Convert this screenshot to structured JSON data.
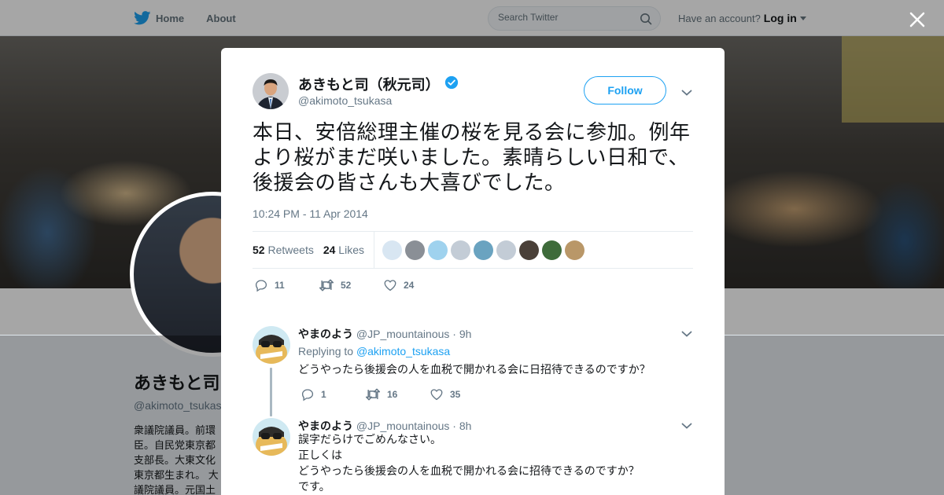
{
  "topbar": {
    "home_label": "Home",
    "about_label": "About",
    "search_placeholder": "Search Twitter",
    "account_prompt": "Have an account?",
    "login_label": "Log in"
  },
  "profile": {
    "name": "あきもと司",
    "handle": "@akimoto_tsukasa",
    "bio_lines": [
      "衆議院議員。前環",
      "臣。自民党東京都",
      "支部長。大東文化",
      "東京都生まれ。 大",
      "議院議員。元国土"
    ]
  },
  "tweet": {
    "author_name": "あきもと司（秋元司）",
    "author_handle": "@akimoto_tsukasa",
    "follow_label": "Follow",
    "text": "本日、安倍総理主催の桜を見る会に参加。例年より桜がまだ咲いました。素晴らしい日和で、後援会の皆さんも大喜びでした。",
    "timestamp": "10:24 PM - 11 Apr 2014",
    "retweets_count": "52",
    "retweets_label": "Retweets",
    "likes_count": "24",
    "likes_label": "Likes",
    "likers": [
      {
        "color": "#d8e6f2"
      },
      {
        "color": "#8a8f96"
      },
      {
        "color": "#9fd2ee"
      },
      {
        "color": "#c3ccd6"
      },
      {
        "color": "#6aa3c0"
      },
      {
        "color": "#c3ccd6"
      },
      {
        "color": "#4a4038"
      },
      {
        "color": "#3e6b3a"
      },
      {
        "color": "#b99768"
      }
    ],
    "actions": {
      "replies": "11",
      "retweets": "52",
      "likes": "24"
    }
  },
  "replies": [
    {
      "name": "やまのよう",
      "handle": "@JP_mountainous",
      "time": "· 9h",
      "replying_prefix": "Replying to",
      "replying_to": "@akimoto_tsukasa",
      "text_lines": [
        "どうやったら後援会の人を血税で開かれる会に日招待できるのですか？"
      ],
      "actions": {
        "replies": "1",
        "retweets": "16",
        "likes": "35"
      }
    },
    {
      "name": "やまのよう",
      "handle": "@JP_mountainous",
      "time": "· 8h",
      "text_lines": [
        "誤字だらけでごめんなさい。",
        "正しくは",
        "どうやったら後援会の人を血税で開かれる会に招待できるのですか？",
        "です。"
      ]
    }
  ],
  "colors": {
    "accent": "#1da1f2",
    "verified": "#1da1f2",
    "muted": "#657786",
    "text": "#14171a"
  }
}
